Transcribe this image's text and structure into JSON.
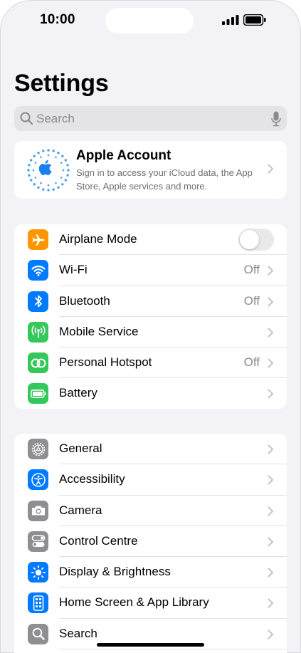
{
  "status_bar": {
    "time": "10:00"
  },
  "page": {
    "title": "Settings"
  },
  "search": {
    "placeholder": "Search"
  },
  "account": {
    "title": "Apple Account",
    "subtitle": "Sign in to access your iCloud data, the App Store, Apple services and more."
  },
  "group1": {
    "rows": [
      {
        "label": "Airplane Mode",
        "icon": "airplane-icon",
        "color": "#ff9500",
        "toggle": false
      },
      {
        "label": "Wi-Fi",
        "icon": "wifi-icon",
        "color": "#007aff",
        "value": "Off"
      },
      {
        "label": "Bluetooth",
        "icon": "bluetooth-icon",
        "color": "#007aff",
        "value": "Off"
      },
      {
        "label": "Mobile Service",
        "icon": "antenna-icon",
        "color": "#34c759"
      },
      {
        "label": "Personal Hotspot",
        "icon": "hotspot-icon",
        "color": "#34c759",
        "value": "Off"
      },
      {
        "label": "Battery",
        "icon": "battery-icon",
        "color": "#34c759"
      }
    ]
  },
  "group2": {
    "rows": [
      {
        "label": "General",
        "icon": "gear-icon",
        "color": "#8e8e93"
      },
      {
        "label": "Accessibility",
        "icon": "accessibility-icon",
        "color": "#007aff"
      },
      {
        "label": "Camera",
        "icon": "camera-icon",
        "color": "#8e8e93"
      },
      {
        "label": "Control Centre",
        "icon": "control-centre-icon",
        "color": "#8e8e93"
      },
      {
        "label": "Display & Brightness",
        "icon": "brightness-icon",
        "color": "#007aff"
      },
      {
        "label": "Home Screen & App Library",
        "icon": "home-screen-icon",
        "color": "#007aff"
      },
      {
        "label": "Search",
        "icon": "search-icon",
        "color": "#8e8e93"
      }
    ]
  }
}
